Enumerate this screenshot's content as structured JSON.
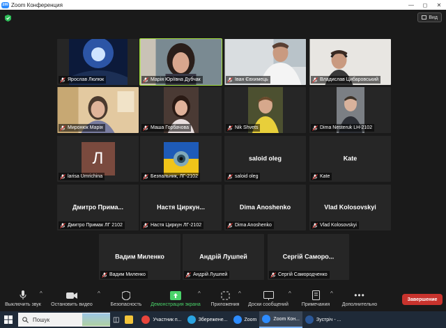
{
  "window": {
    "title": "Zoom Конференция"
  },
  "header": {
    "view_label": "Вид"
  },
  "participants": [
    {
      "name": "Ярослав Люлюк",
      "kind": "video",
      "scene": "space"
    },
    {
      "name": "Марія Юріївна Дубчак",
      "kind": "video",
      "scene": "woman",
      "active": true
    },
    {
      "name": "Іван Євхимець",
      "kind": "video",
      "scene": "man-white"
    },
    {
      "name": "Владислав Цибаровський",
      "kind": "video",
      "scene": "man-headset"
    },
    {
      "name": "Миронюк Марія",
      "kind": "video",
      "scene": "girl-room"
    },
    {
      "name": "Маша Горбачова",
      "kind": "video",
      "scene": "girl-dark"
    },
    {
      "name": "Nik Shvets",
      "kind": "video",
      "scene": "boy-yellow"
    },
    {
      "name": "Dima Nesteruk LH-2102",
      "kind": "video",
      "scene": "boy-grey"
    },
    {
      "name": "larisa Umrichina",
      "kind": "avatar",
      "avatar_letter": "Л"
    },
    {
      "name": "Безпальник, ЛГ-2102",
      "kind": "flag"
    },
    {
      "name": "saloid oleg",
      "kind": "name",
      "display": "saloid oleg"
    },
    {
      "name": "Kate",
      "kind": "name",
      "display": "Kate"
    },
    {
      "name": "Дмитро Примак ЛГ 2102",
      "kind": "name",
      "display": "Дмитро  Прима..."
    },
    {
      "name": "Настя Циркун ЛГ-2102",
      "kind": "name",
      "display": "Настя  Циркун..."
    },
    {
      "name": "Dima Anoshenko",
      "kind": "name",
      "display": "Dima Anoshenko"
    },
    {
      "name": "Vlad Kolosovskyi",
      "kind": "name",
      "display": "Vlad Kolosovskyi"
    },
    {
      "name": "Вадим Миленко",
      "kind": "name",
      "display": "Вадим Миленко"
    },
    {
      "name": "Андрій Лушпей",
      "kind": "name",
      "display": "Андрій Лушпей"
    },
    {
      "name": "Сергій Самородченко",
      "kind": "name",
      "display": "Сергій  Саморо..."
    }
  ],
  "toolbar": {
    "mute": "Выключить звук",
    "video": "Остановить видео",
    "security": "Безопасность",
    "share": "Демонстрация экрана",
    "apps": "Приложения",
    "whiteboard": "Доски сообщений",
    "notes": "Примечания",
    "more": "Дополнительно",
    "end": "Завершение"
  },
  "taskbar": {
    "search_placeholder": "Пошук",
    "apps": [
      {
        "label": "Участник п...",
        "color": "#e8453c"
      },
      {
        "label": "Збережене...",
        "color": "#2aa3e0"
      },
      {
        "label": "Zoom",
        "color": "#2d8cff"
      },
      {
        "label": "Zoom Кон...",
        "color": "#2d8cff"
      },
      {
        "label": "Зустріч - ...",
        "color": "#2b5797"
      }
    ]
  },
  "colors": {
    "active_speaker": "#a6e23d",
    "end_button": "#c8332d",
    "share_green": "#4ad36a",
    "zoom_blue": "#2d8cff"
  }
}
